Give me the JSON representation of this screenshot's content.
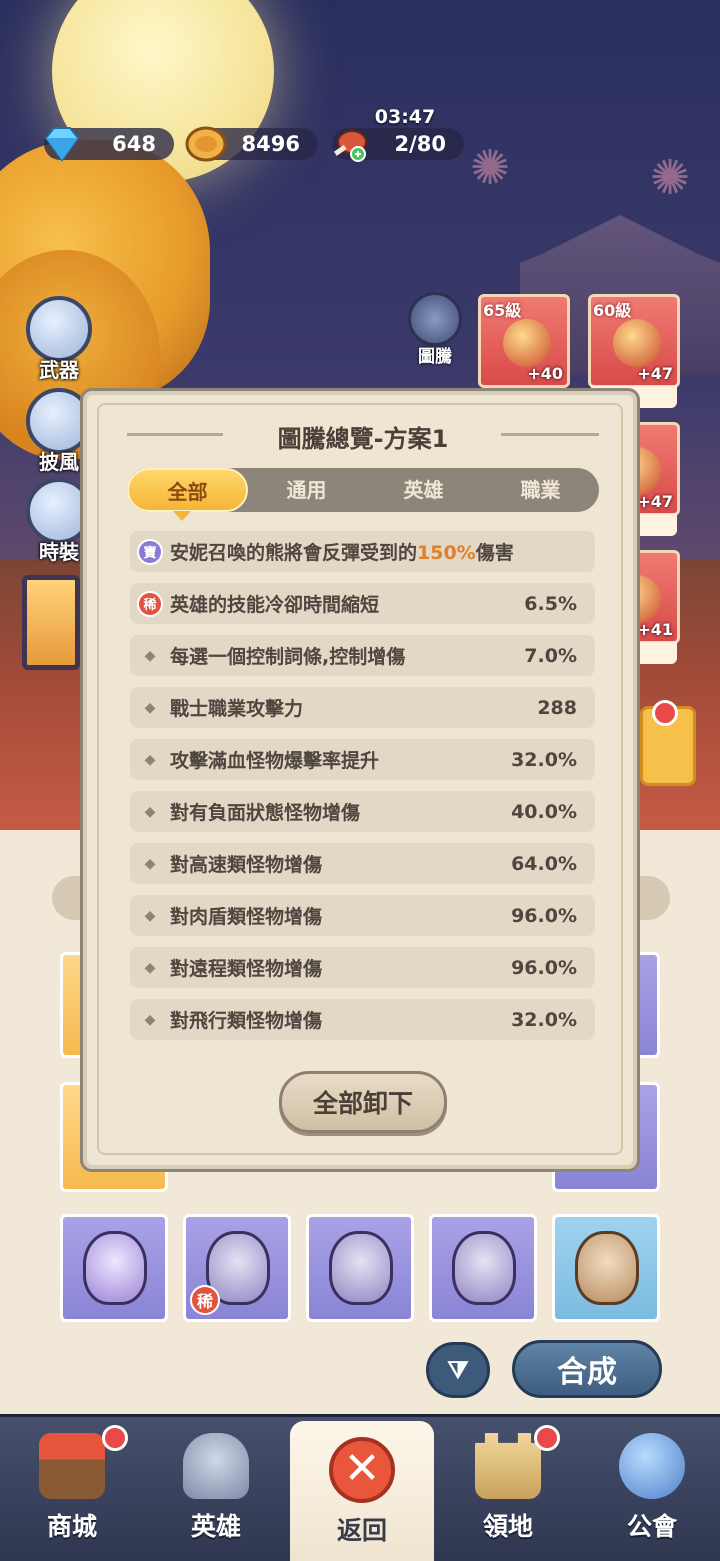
{
  "currency": {
    "diamonds": "648",
    "coins": "8496",
    "stamina": "2/80",
    "stamina_timer": "03:47"
  },
  "side_buttons": [
    {
      "label": "武器",
      "icon": "weapon-icon"
    },
    {
      "label": "披風",
      "icon": "cape-icon"
    },
    {
      "label": "時裝",
      "icon": "costume-icon"
    }
  ],
  "totem_button": {
    "label": "圖騰",
    "icon": "totem-icon"
  },
  "gear_cards": [
    {
      "level": "65級",
      "plus": "+40"
    },
    {
      "level": "60級",
      "plus": "+47"
    },
    {
      "level": "",
      "plus": "+47"
    },
    {
      "level": "",
      "plus": "+41"
    }
  ],
  "modal": {
    "title": "圖騰總覽-方案1",
    "tabs": [
      {
        "label": "全部",
        "active": true
      },
      {
        "label": "通用",
        "active": false
      },
      {
        "label": "英雄",
        "active": false
      },
      {
        "label": "職業",
        "active": false
      }
    ],
    "rows": [
      {
        "badge": "寶",
        "badge_color": "#8b7ad1",
        "text_pre": "安妮召喚的熊將會反彈受到的",
        "highlight": "150%",
        "text_post": "傷害",
        "value": ""
      },
      {
        "badge": "稀",
        "badge_color": "#e2523d",
        "text_pre": "英雄的技能冷卻時間縮短",
        "highlight": "",
        "text_post": "",
        "value": "6.5%"
      },
      {
        "badge": "",
        "text_pre": "每選一個控制詞條,控制增傷",
        "highlight": "",
        "text_post": "",
        "value": "7.0%"
      },
      {
        "badge": "",
        "text_pre": "戰士職業攻擊力",
        "highlight": "",
        "text_post": "",
        "value": "288"
      },
      {
        "badge": "",
        "text_pre": "攻擊滿血怪物爆擊率提升",
        "highlight": "",
        "text_post": "",
        "value": "32.0%"
      },
      {
        "badge": "",
        "text_pre": "對有負面狀態怪物增傷",
        "highlight": "",
        "text_post": "",
        "value": "40.0%"
      },
      {
        "badge": "",
        "text_pre": "對高速類怪物增傷",
        "highlight": "",
        "text_post": "",
        "value": "64.0%"
      },
      {
        "badge": "",
        "text_pre": "對肉盾類怪物增傷",
        "highlight": "",
        "text_post": "",
        "value": "96.0%"
      },
      {
        "badge": "",
        "text_pre": "對遠程類怪物增傷",
        "highlight": "",
        "text_post": "",
        "value": "96.0%"
      },
      {
        "badge": "",
        "text_pre": "對飛行類怪物增傷",
        "highlight": "",
        "text_post": "",
        "value": "32.0%"
      }
    ],
    "unload_all_label": "全部卸下"
  },
  "inventory": {
    "rare_badge": "稀",
    "compose_label": "合成",
    "filter_icon": "filter-icon"
  },
  "bottom_nav": [
    {
      "label": "商城",
      "icon": "shop-icon",
      "dot": true
    },
    {
      "label": "英雄",
      "icon": "helmet-icon",
      "dot": false
    },
    {
      "label": "返回",
      "icon": "close-icon",
      "dot": false,
      "active": true
    },
    {
      "label": "領地",
      "icon": "castle-icon",
      "dot": true
    },
    {
      "label": "公會",
      "icon": "planet-icon",
      "dot": false
    }
  ],
  "colors": {
    "tab_active": "#f4b637",
    "highlight": "#e07f2c",
    "rare_badge": "#e2523d",
    "treasure_badge": "#8b7ad1",
    "red_dot": "#e84a4a"
  }
}
